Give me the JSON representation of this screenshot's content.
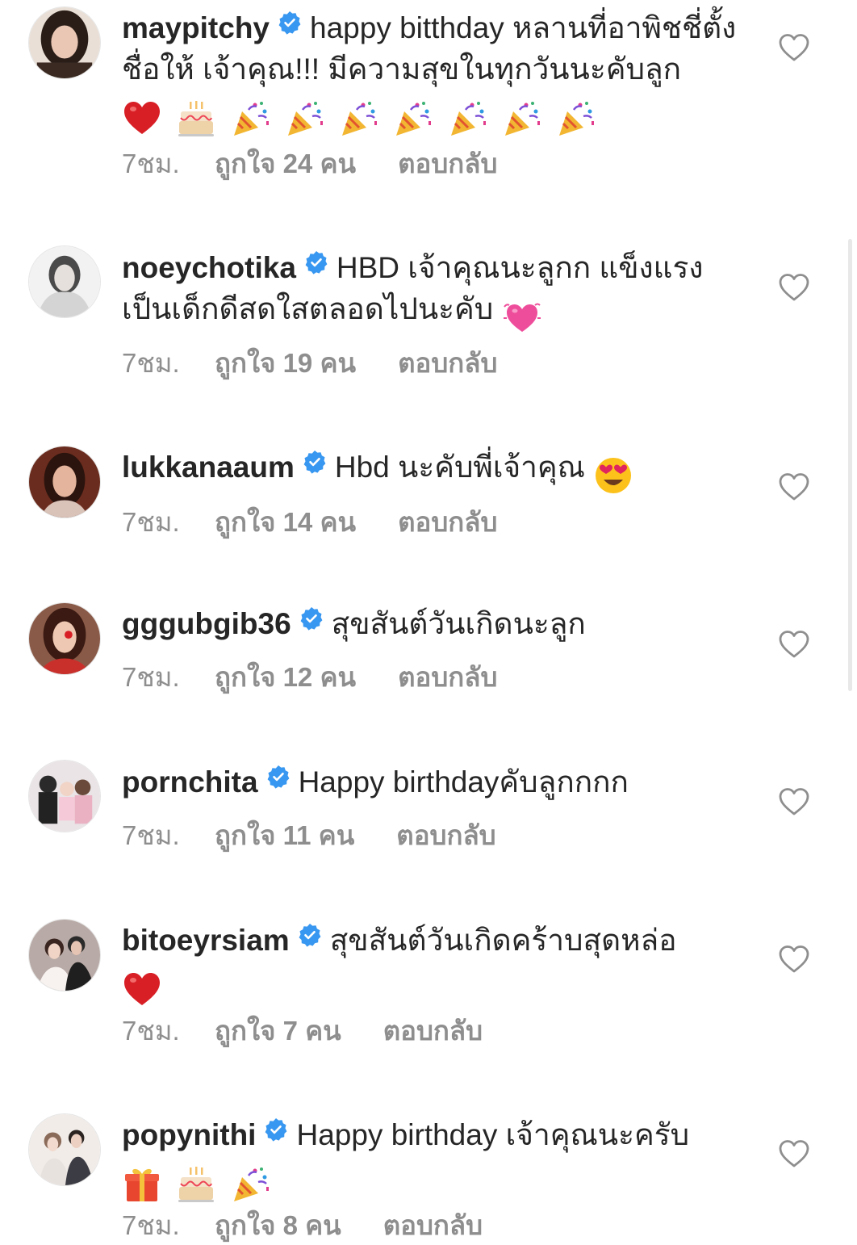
{
  "verified_icon": "verified-badge-icon",
  "verified_color": "#3897f0",
  "like_icon": "heart-outline-icon",
  "comments": [
    {
      "username": "maypitchy",
      "text": "happy bitthday หลานที่อาพิชชี่ตั้งชื่อให้ เจ้าคุณ!!! มีความสุขในทุกวันนะคับลูก",
      "emojis": [
        "red-heart",
        "birthday-cake",
        "party-popper",
        "party-popper",
        "party-popper",
        "party-popper",
        "party-popper",
        "party-popper",
        "party-popper"
      ],
      "time": "7ชม.",
      "likes": "ถูกใจ 24 คน",
      "reply": "ตอบกลับ",
      "avatar_color": "#3a2a22"
    },
    {
      "username": "noeychotika",
      "text": "HBD เจ้าคุณนะลูกก แข็งแรงเป็นเด็กดีสดใสตลอดไปนะคับ",
      "emojis": [
        "growing-heart"
      ],
      "time": "7ชม.",
      "likes": "ถูกใจ 19 คน",
      "reply": "ตอบกลับ",
      "avatar_color": "#d9d9d9"
    },
    {
      "username": "lukkanaaum",
      "text": "Hbd นะคับพี่เจ้าคุณ",
      "emojis": [
        "heart-eyes"
      ],
      "time": "7ชม.",
      "likes": "ถูกใจ 14 คน",
      "reply": "ตอบกลับ",
      "avatar_color": "#4a2218"
    },
    {
      "username": "gggubgib36",
      "text": "สุขสันต์วันเกิดนะลูก",
      "emojis": [],
      "time": "7ชม.",
      "likes": "ถูกใจ 12 คน",
      "reply": "ตอบกลับ",
      "avatar_color": "#5a2a1e"
    },
    {
      "username": "pornchita",
      "text": "Happy birthdayคับลูกกกก",
      "emojis": [],
      "time": "7ชม.",
      "likes": "ถูกใจ 11 คน",
      "reply": "ตอบกลับ",
      "avatar_color": "#c9c3c6"
    },
    {
      "username": "bitoeyrsiam",
      "text": "สุขสันต์วันเกิดคร้าบสุดหล่อ",
      "emojis": [
        "red-heart"
      ],
      "time": "7ชม.",
      "likes": "ถูกใจ 7 คน",
      "reply": "ตอบกลับ",
      "avatar_color": "#8a7a78"
    },
    {
      "username": "popynithi",
      "text": "Happy birthday เจ้าคุณนะครับ",
      "emojis": [
        "wrapped-gift",
        "birthday-cake",
        "party-popper"
      ],
      "time": "7ชม.",
      "likes": "ถูกใจ 8 คน",
      "reply": "ตอบกลับ",
      "avatar_color": "#e4e0dc"
    }
  ]
}
